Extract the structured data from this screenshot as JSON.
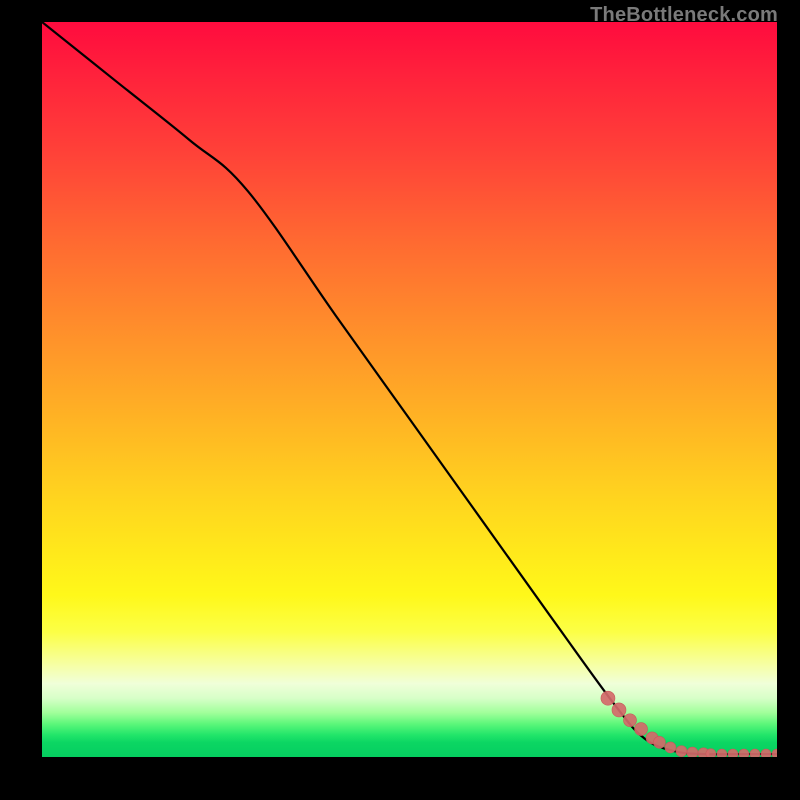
{
  "watermark": "TheBottleneck.com",
  "colors": {
    "curve_stroke": "#000000",
    "marker_fill": "#d46a6a",
    "marker_stroke": "#c75a5a"
  },
  "chart_data": {
    "type": "line",
    "title": "",
    "xlabel": "",
    "ylabel": "",
    "xlim": [
      0,
      100
    ],
    "ylim": [
      0,
      100
    ],
    "grid": false,
    "legend": false,
    "series": [
      {
        "name": "curve",
        "x": [
          0,
          10,
          20,
          28,
          40,
          50,
          60,
          70,
          78,
          82,
          86,
          90,
          95,
          100
        ],
        "y": [
          100,
          92,
          84,
          77,
          60,
          46,
          32,
          18,
          7,
          2.5,
          0.8,
          0.4,
          0.4,
          0.4
        ]
      }
    ],
    "markers": {
      "name": "highlight-points",
      "x": [
        77,
        78.5,
        80,
        81.5,
        83,
        84,
        85.5,
        87,
        88.5,
        90,
        91,
        92.5,
        94,
        95.5,
        97,
        98.5,
        100
      ],
      "y": [
        8.0,
        6.4,
        5.0,
        3.8,
        2.6,
        2.0,
        1.3,
        0.8,
        0.6,
        0.5,
        0.45,
        0.4,
        0.4,
        0.4,
        0.4,
        0.4,
        0.4
      ],
      "r": [
        7,
        7,
        6.5,
        6.5,
        6,
        6,
        5.5,
        5.5,
        5.5,
        5.5,
        5.0,
        5.0,
        5.0,
        5.0,
        5.0,
        5.0,
        5.0
      ]
    }
  }
}
